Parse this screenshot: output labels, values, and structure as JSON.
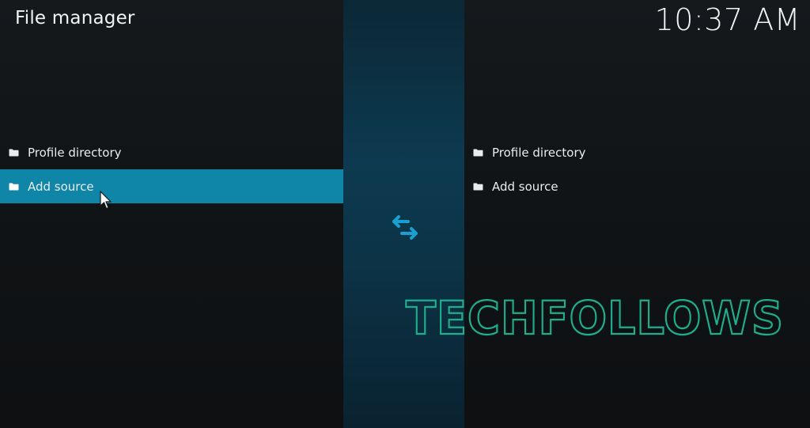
{
  "header": {
    "title": "File manager",
    "clock": "10:37 AM"
  },
  "left_pane": {
    "items": [
      {
        "label": "Profile directory",
        "icon": "folder-icon",
        "selected": false
      },
      {
        "label": "Add source",
        "icon": "folder-icon",
        "selected": true
      }
    ]
  },
  "right_pane": {
    "items": [
      {
        "label": "Profile directory",
        "icon": "folder-icon"
      },
      {
        "label": "Add source",
        "icon": "folder-icon"
      }
    ]
  },
  "center": {
    "icon": "swap-arrows-icon"
  },
  "watermark": {
    "text": "TECHFOLLOWS"
  },
  "colors": {
    "background": "#111416",
    "selected_row": "#0f86a8",
    "center_strip": "#0d3a50",
    "accent_icon": "#1aa0d0",
    "watermark": "#1fae8c"
  }
}
